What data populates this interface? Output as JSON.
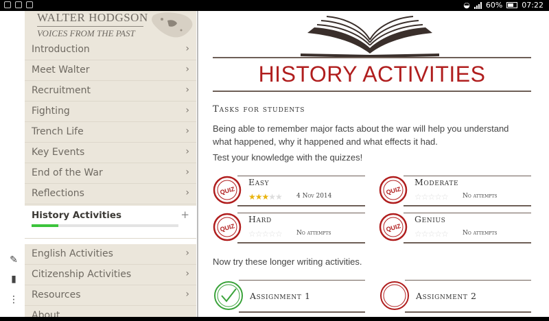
{
  "status_bar": {
    "battery": "60%",
    "time": "07:22"
  },
  "brand": {
    "title": "WALTER HODGSON",
    "subtitle": "VOICES FROM THE PAST"
  },
  "nav": {
    "items": [
      {
        "label": "Introduction"
      },
      {
        "label": "Meet Walter"
      },
      {
        "label": "Recruitment"
      },
      {
        "label": "Fighting"
      },
      {
        "label": "Trench Life"
      },
      {
        "label": "Key Events"
      },
      {
        "label": "End of the War"
      },
      {
        "label": "Reflections"
      }
    ],
    "active": {
      "label": "History Activities",
      "progress": 0.18
    },
    "lower_items": [
      {
        "label": "English Activities"
      },
      {
        "label": "Citizenship Activities"
      },
      {
        "label": "Resources"
      },
      {
        "label": "About"
      }
    ],
    "chevron": "›",
    "plus": "+"
  },
  "page": {
    "title": "HISTORY ACTIVITIES",
    "tasks_heading": "Tasks for students",
    "intro_line1": "Being able to remember major facts about the war will help you understand",
    "intro_line2": "what happened, why it happened and what effects it had.",
    "intro_line3": "Test your knowledge with the quizzes!",
    "writing_intro": "Now try these longer writing activities."
  },
  "quizzes": [
    {
      "name": "Easy",
      "stars": 3,
      "meta": "4 Nov 2014",
      "badge_text": "QUIZ"
    },
    {
      "name": "Moderate",
      "stars": 0,
      "meta": "No attempts",
      "badge_text": "QUIZ"
    },
    {
      "name": "Hard",
      "stars": 0,
      "meta": "No attempts",
      "badge_text": "QUIZ"
    },
    {
      "name": "Genius",
      "stars": 0,
      "meta": "No attempts",
      "badge_text": "QUIZ"
    }
  ],
  "assignments": [
    {
      "name": "Assignment 1",
      "completed": true
    },
    {
      "name": "Assignment 2",
      "completed": false
    }
  ],
  "colors": {
    "accent_red": "#b01e1e",
    "progress_green": "#3cc43c",
    "star_gold": "#e9b40f",
    "check_green": "#3aa33a"
  },
  "icons": [
    "add-note-icon",
    "add-bookmark-icon",
    "more-icon"
  ]
}
